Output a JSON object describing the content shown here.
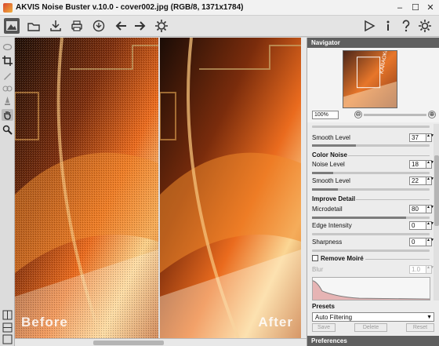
{
  "window": {
    "title": "AKVIS Noise Buster v.10.0 - cover002.jpg (RGB/8, 1371x1784)",
    "controls": {
      "minimize": "–",
      "maximize": "☐",
      "close": "✕"
    }
  },
  "toolbar": {
    "left_icons": [
      "image-icon",
      "open-icon",
      "save-icon",
      "print-icon",
      "share-icon",
      "back-icon",
      "forward-icon",
      "gear-icon"
    ],
    "right_icons": [
      "play-icon",
      "info-icon",
      "help-icon",
      "settings-icon"
    ]
  },
  "left_tools": [
    "crop-icon",
    "pencil-icon",
    "eraser-icon",
    "stamp-icon",
    "hand-icon",
    "zoom-icon"
  ],
  "canvas": {
    "before_label": "Before",
    "after_label": "After"
  },
  "navigator": {
    "title": "Navigator",
    "thumbnail_text": "KARAOKE",
    "zoom_value": "100%",
    "zoom_out": "⊖",
    "zoom_in": "⊕",
    "zoom_level": 0.6
  },
  "settings": {
    "smooth_level_1": {
      "label": "Smooth Level",
      "value": "37",
      "fraction": 0.37
    },
    "color_noise": {
      "title": "Color Noise",
      "noise_level": {
        "label": "Noise Level",
        "value": "18",
        "fraction": 0.18
      },
      "smooth_level": {
        "label": "Smooth Level",
        "value": "22",
        "fraction": 0.22
      }
    },
    "improve_detail": {
      "title": "Improve Detail",
      "microdetail": {
        "label": "Microdetail",
        "value": "80",
        "fraction": 0.8
      },
      "edge_intensity": {
        "label": "Edge Intensity",
        "value": "0",
        "fraction": 0
      },
      "sharpness": {
        "label": "Sharpness",
        "value": "0",
        "fraction": 0
      }
    },
    "remove_moire": {
      "title": "Remove Moiré",
      "blur_label": "Blur",
      "blur_value": "1.0"
    },
    "spin_symbol": "▲▼"
  },
  "presets": {
    "title": "Presets",
    "selected": "Auto Filtering",
    "arrow": "▼",
    "save_label": "Save",
    "delete_label": "Delete",
    "reset_label": "Reset"
  },
  "preferences": {
    "title": "Preferences"
  },
  "colors": {
    "panel_header": "#5f5f5f",
    "image_orange": "#f07a1e",
    "image_dark": "#2a1408"
  }
}
